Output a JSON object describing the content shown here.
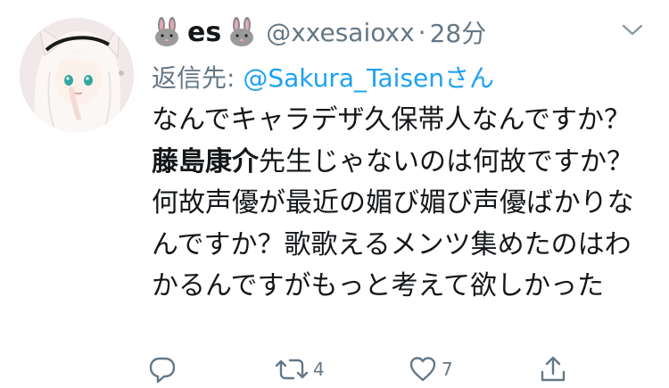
{
  "tweet": {
    "display_name": "es",
    "name_emoji_left": "rabbit-face-emoji",
    "name_emoji_right": "rabbit-face-emoji",
    "handle": "@xxesaioxx",
    "separator": "·",
    "time": "28分",
    "reply_prefix": "返信先: ",
    "reply_mention": "@Sakura_Taisen",
    "reply_suffix": "さん",
    "body_part1": "なんでキャラデザ久保帯人なんですか？",
    "body_bold": "藤島康介",
    "body_part2": "先生じゃないのは何故ですか？何故声優が最近の媚び媚び声優ばかりなんですか？歌歌えるメンツ集めたのはわかるんですがもっと考えて欲しかった"
  },
  "actions": {
    "reply": {
      "icon": "reply-bubble-icon",
      "count": ""
    },
    "retweet": {
      "icon": "retweet-icon",
      "count": "4"
    },
    "like": {
      "icon": "heart-icon",
      "count": "7"
    },
    "share": {
      "icon": "share-icon",
      "count": ""
    }
  },
  "menu": {
    "icon": "chevron-down-icon"
  },
  "colors": {
    "text": "#14171a",
    "secondary": "#657786",
    "link": "#1da1f2"
  }
}
